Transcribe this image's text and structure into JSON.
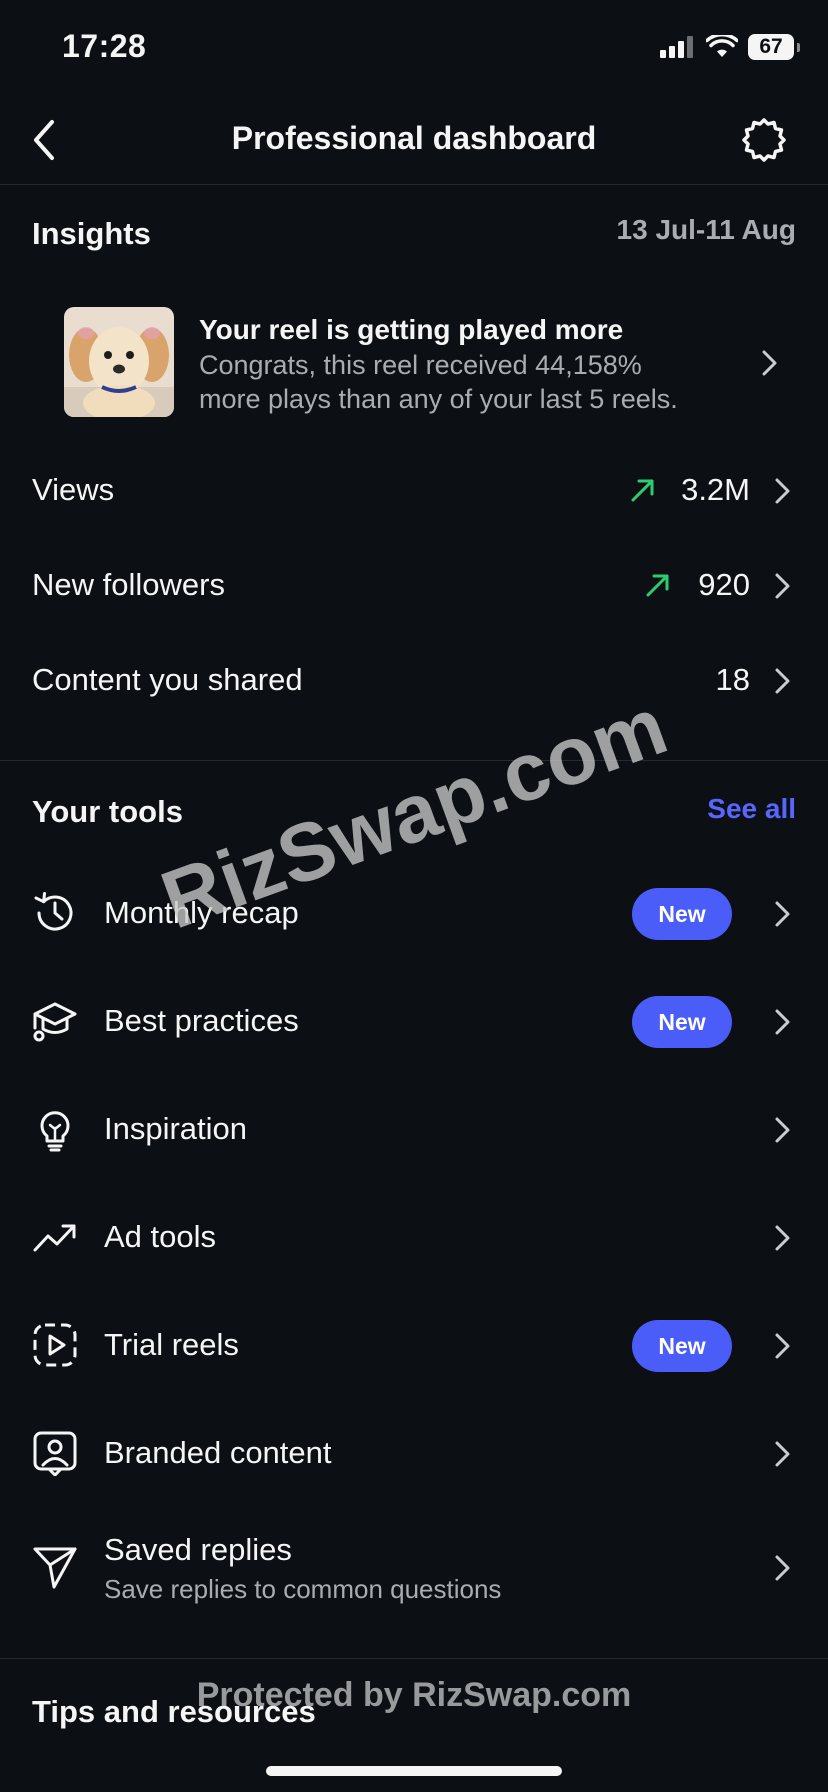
{
  "status_bar": {
    "time": "17:28",
    "battery": "67"
  },
  "header": {
    "title": "Professional dashboard",
    "back_icon": "chevron-left-icon",
    "settings_icon": "gear-icon"
  },
  "insights": {
    "title": "Insights",
    "date_range": "13 Jul-11 Aug",
    "highlight": {
      "title": "Your reel is getting played more",
      "subtitle_line1": "Congrats, this reel received 44,158%",
      "subtitle_line2": "more plays than any of your last 5 reels."
    },
    "rows": [
      {
        "label": "Views",
        "value": "3.2M",
        "trend": "up"
      },
      {
        "label": "New followers",
        "value": "920",
        "trend": "up"
      },
      {
        "label": "Content you shared",
        "value": "18"
      }
    ]
  },
  "tools": {
    "title": "Your tools",
    "see_all": "See all",
    "items": [
      {
        "label": "Monthly recap",
        "icon": "history-icon",
        "badge": "New"
      },
      {
        "label": "Best practices",
        "icon": "graduation-cap-icon",
        "badge": "New"
      },
      {
        "label": "Inspiration",
        "icon": "lightbulb-icon"
      },
      {
        "label": "Ad tools",
        "icon": "trending-up-icon"
      },
      {
        "label": "Trial reels",
        "icon": "reel-play-icon",
        "badge": "New"
      },
      {
        "label": "Branded content",
        "icon": "person-badge-icon"
      },
      {
        "label": "Saved replies",
        "subtitle": "Save replies to common questions",
        "icon": "send-icon"
      }
    ]
  },
  "tips": {
    "title": "Tips and resources"
  },
  "watermarks": {
    "diagonal": "RizSwap.com",
    "footer": "Protected by RizSwap.com"
  },
  "colors": {
    "background": "#0c1014",
    "accent": "#4a5df9",
    "link": "#5865ff",
    "trend_up": "#2ecc71",
    "muted": "#a8adb3"
  }
}
